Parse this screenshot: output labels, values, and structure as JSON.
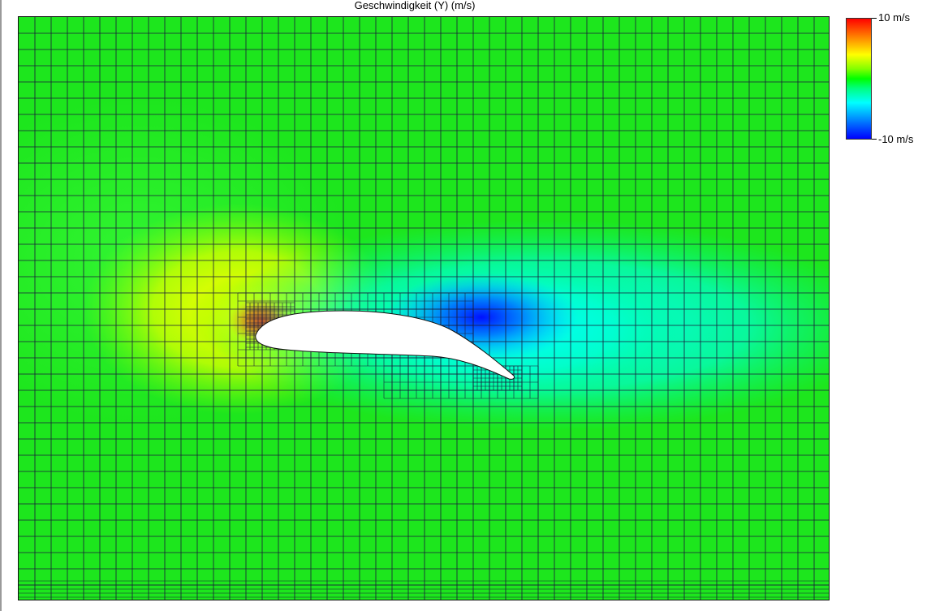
{
  "title": "Geschwindigkeit (Y) (m/s)",
  "colorbar": {
    "max_label": "10 m/s",
    "min_label": "-10 m/s",
    "max_value": 10,
    "min_value": -10,
    "colormap": "jet"
  },
  "field": {
    "quantity": "velocity-y",
    "background_color": "#1de61d",
    "max_color": "#ff2000",
    "min_color": "#0010ff"
  },
  "mesh": {
    "line_color": "#1a1a3a"
  }
}
